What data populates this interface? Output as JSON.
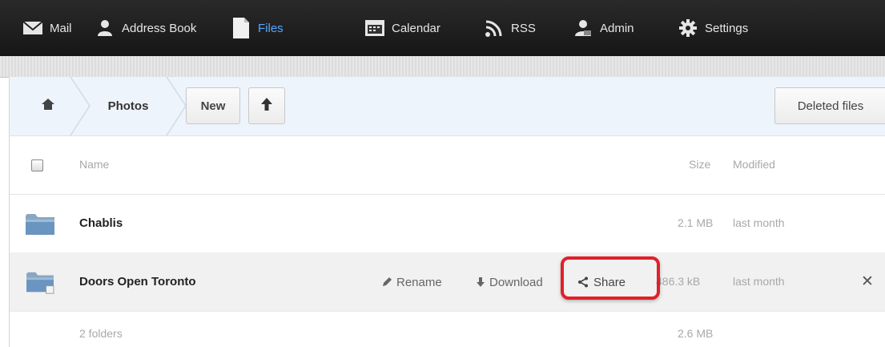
{
  "nav": {
    "mail": "Mail",
    "address_book": "Address Book",
    "files": "Files",
    "calendar": "Calendar",
    "rss": "RSS",
    "admin": "Admin",
    "settings": "Settings",
    "active": "Files"
  },
  "toolbar": {
    "breadcrumb_folder": "Photos",
    "new_button": "New",
    "deleted_files_button": "Deleted files"
  },
  "table": {
    "columns": {
      "name": "Name",
      "size": "Size",
      "modified": "Modified"
    },
    "rows": [
      {
        "name": "Chablis",
        "size": "2.1 MB",
        "modified": "last month"
      },
      {
        "name": "Doors Open Toronto",
        "size": "486.3 kB",
        "modified": "last month"
      }
    ],
    "row_actions": {
      "rename": "Rename",
      "download": "Download",
      "share": "Share"
    },
    "summary": {
      "folders": "2 folders",
      "total_size": "2.6 MB"
    }
  },
  "colors": {
    "accent_active_tab": "#55a8ff",
    "highlight": "#e0202a"
  }
}
